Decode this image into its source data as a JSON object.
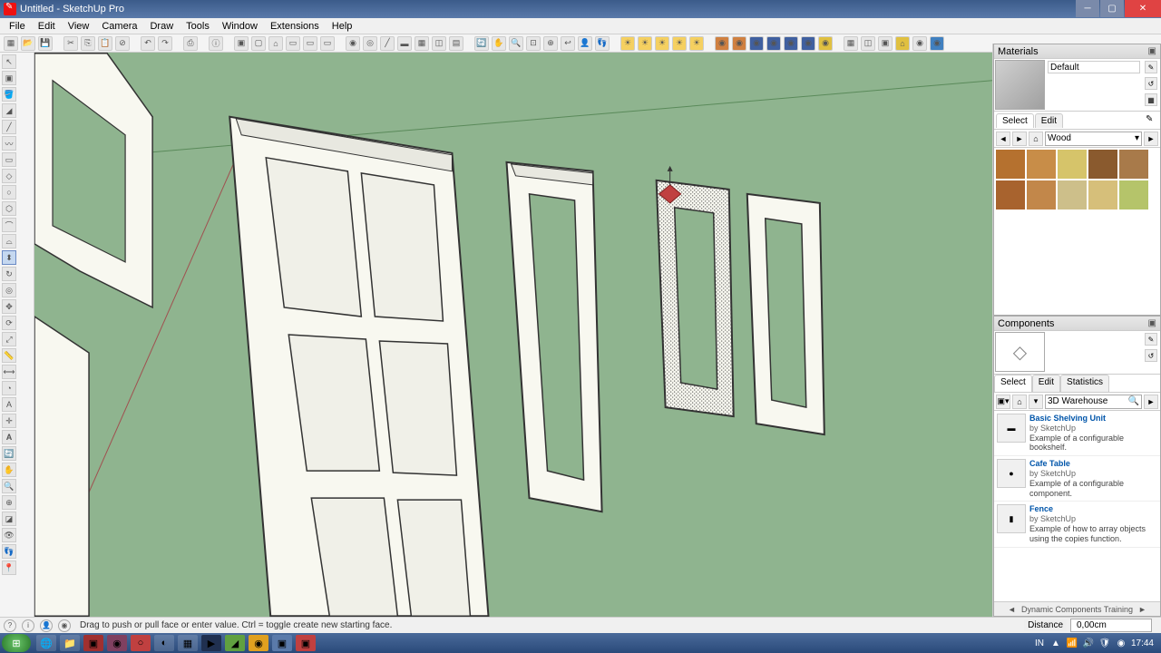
{
  "window": {
    "title": "Untitled - SketchUp Pro"
  },
  "menu": [
    "File",
    "Edit",
    "View",
    "Camera",
    "Draw",
    "Tools",
    "Window",
    "Extensions",
    "Help"
  ],
  "materials": {
    "panel_title": "Materials",
    "name": "Default",
    "tabs": {
      "select": "Select",
      "edit": "Edit"
    },
    "library": "Wood",
    "swatches": [
      "#b5712f",
      "#c88d48",
      "#d6c46a",
      "#8a5a2e",
      "#a87a4a",
      "#a8632e",
      "#c2874a",
      "#cdbf8a",
      "#d6bf7a",
      "#b5c46a"
    ]
  },
  "components": {
    "panel_title": "Components",
    "tabs": {
      "select": "Select",
      "edit": "Edit",
      "stats": "Statistics"
    },
    "search_source": "3D Warehouse",
    "items": [
      {
        "title": "Basic Shelving Unit",
        "by": "by SketchUp",
        "desc": "Example of a configurable bookshelf.",
        "thumb": "▬"
      },
      {
        "title": "Cafe Table",
        "by": "by SketchUp",
        "desc": "Example of a configurable component.",
        "thumb": "●"
      },
      {
        "title": "Fence",
        "by": "by SketchUp",
        "desc": "Example of how to array objects using the copies function.",
        "thumb": "▮"
      }
    ],
    "footer": "Dynamic Components Training"
  },
  "status": {
    "hint": "Drag to push or pull face or enter value. Ctrl = toggle create new starting face.",
    "distance_label": "Distance",
    "distance_value": "0,00cm"
  },
  "tray": {
    "lang": "IN",
    "time": "17:44"
  }
}
